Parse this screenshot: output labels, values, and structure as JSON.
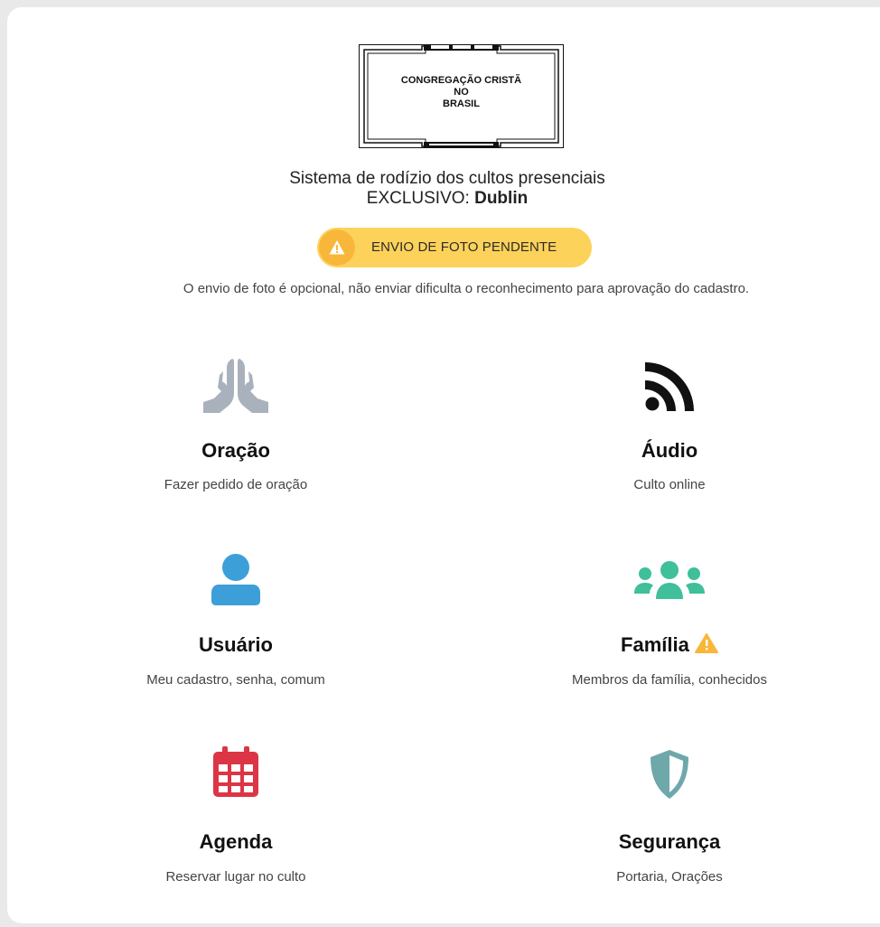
{
  "logo": {
    "line1": "CONGREGAÇÃO CRISTÃ",
    "line2": "NO",
    "line3": "BRASIL"
  },
  "header": {
    "subtitle": "Sistema de rodízio dos cultos presenciais",
    "exclusive_label": "EXCLUSIVO: ",
    "exclusive_value": "Dublin"
  },
  "badge": {
    "label": "ENVIO DE FOTO PENDENTE",
    "icon": "warning-icon",
    "color": "#fdd25a"
  },
  "note": "O envio de foto é opcional, não enviar dificulta o reconhecimento para aprovação do cadastro.",
  "menu": [
    {
      "title": "Oração",
      "desc": "Fazer pedido de oração",
      "icon": "praying-hands-icon",
      "color": "#a9b1bd"
    },
    {
      "title": "Áudio",
      "desc": "Culto online",
      "icon": "rss-feed-icon",
      "color": "#111111"
    },
    {
      "title": "Usuário",
      "desc": "Meu cadastro, senha, comum",
      "icon": "user-icon",
      "color": "#3c9fd8"
    },
    {
      "title": "Família",
      "desc": "Membros da família, conhecidos",
      "icon": "users-icon",
      "color": "#3fbf9a"
    },
    {
      "title": "Agenda",
      "desc": "Reservar lugar no culto",
      "icon": "calendar-icon",
      "color": "#dc3545"
    },
    {
      "title": "Segurança",
      "desc": "Portaria, Orações",
      "icon": "shield-icon",
      "color": "#6fa8ab"
    }
  ]
}
